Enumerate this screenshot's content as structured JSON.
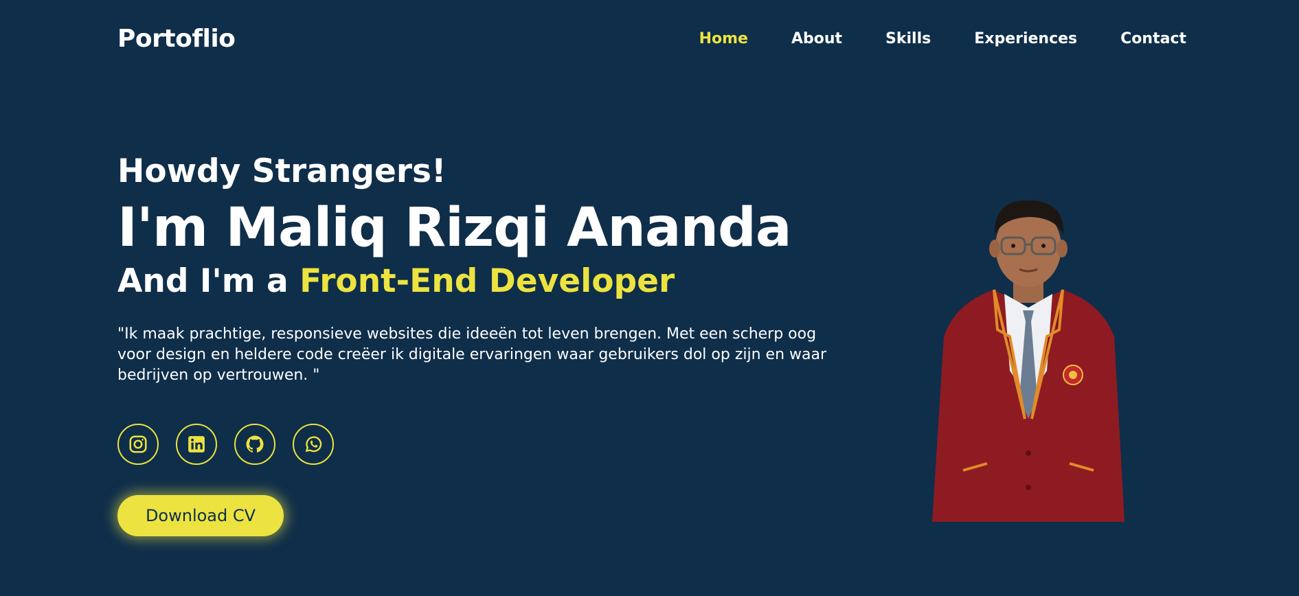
{
  "header": {
    "logo": "Portoflio",
    "nav": [
      {
        "label": "Home",
        "active": true
      },
      {
        "label": "About",
        "active": false
      },
      {
        "label": "Skills",
        "active": false
      },
      {
        "label": "Experiences",
        "active": false
      },
      {
        "label": "Contact",
        "active": false
      }
    ]
  },
  "hero": {
    "greeting": "Howdy Strangers!",
    "name": "I'm Maliq Rizqi Ananda",
    "role_prefix": "And I'm a ",
    "role_highlight": "Front-End Developer",
    "quote": "\"Ik maak prachtige, responsieve websites die ideeën tot leven brengen. Met een scherp oog voor design en heldere code creëer ik digitale ervaringen waar gebruikers dol op zijn en waar bedrijven op vertrouwen. \"",
    "download_label": "Download CV"
  },
  "socials": [
    {
      "icon": "instagram-icon"
    },
    {
      "icon": "linkedin-icon"
    },
    {
      "icon": "github-icon"
    },
    {
      "icon": "whatsapp-icon"
    }
  ],
  "colors": {
    "background": "#0f2e4a",
    "accent": "#ede340",
    "text": "#ffffff",
    "blazer": "#8e1b22"
  }
}
